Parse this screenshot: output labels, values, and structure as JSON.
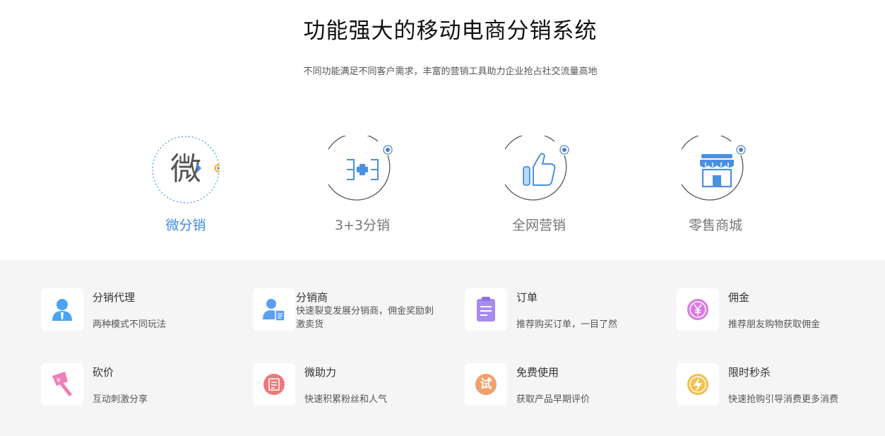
{
  "header": {
    "title": "功能强大的移动电商分销系统",
    "subtitle": "不同功能满足不同客户需求，丰富的营销工具助力企业抢占社交流量高地"
  },
  "features": [
    {
      "label": "微分销",
      "icon": "wei-character-icon",
      "active": true
    },
    {
      "label": "3+3分销",
      "icon": "three-plus-three-icon",
      "active": false
    },
    {
      "label": "全网营销",
      "icon": "thumbs-up-icon",
      "active": false
    },
    {
      "label": "零售商城",
      "icon": "storefront-icon",
      "active": false
    }
  ],
  "wei_glyph": "微",
  "cards": [
    {
      "title": "分销代理",
      "desc": "两种模式不同玩法",
      "icon": "person-icon",
      "color": "#4aa3f3"
    },
    {
      "title": "分销商",
      "desc": "快速裂变发展分销商，佣金奖励刺激卖货",
      "icon": "person-card-icon",
      "color": "#5a9ff0"
    },
    {
      "title": "订单",
      "desc": "推荐购买订单，一目了然",
      "icon": "clipboard-icon",
      "color": "#a78bf0"
    },
    {
      "title": "佣金",
      "desc": "推荐朋友购物获取佣金",
      "icon": "yen-coin-icon",
      "color": "#d87ce0"
    },
    {
      "title": "砍价",
      "desc": "互动刺激分享",
      "icon": "axe-icon",
      "color": "#f07fb6"
    },
    {
      "title": "微助力",
      "desc": "快速积累粉丝和人气",
      "icon": "book-icon",
      "color": "#f0777a"
    },
    {
      "title": "免费使用",
      "desc": "获取产品早期评价",
      "icon": "trial-icon",
      "color": "#f3a06a",
      "glyph": "试"
    },
    {
      "title": "限时秒杀",
      "desc": "快速抢购引导消费更多消费",
      "icon": "lightning-icon",
      "color": "#f5c04f"
    }
  ],
  "colors": {
    "accent": "#3f8ae0",
    "panel_bg": "#f5f5f5",
    "ring": "#555555",
    "badge": "#4a80c8"
  }
}
